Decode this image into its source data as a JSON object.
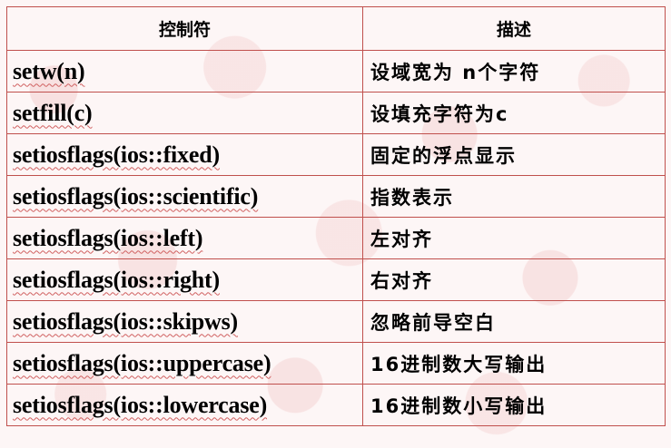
{
  "table": {
    "headers": {
      "control": "控制符",
      "description": "描述"
    },
    "rows": [
      {
        "control": "setw(n)",
        "description": "设域宽为 n个字符"
      },
      {
        "control": "setfill(c)",
        "description": "设填充字符为c"
      },
      {
        "control": "setiosflags(ios::fixed)",
        "description": "固定的浮点显示"
      },
      {
        "control": "setiosflags(ios::scientific)",
        "description": "指数表示"
      },
      {
        "control": "setiosflags(ios::left)",
        "description": "左对齐"
      },
      {
        "control": "setiosflags(ios::right)",
        "description": "右对齐"
      },
      {
        "control": "setiosflags(ios::skipws)",
        "description": "忽略前导空白"
      },
      {
        "control": "setiosflags(ios::uppercase)",
        "description": "16进制数大写输出"
      },
      {
        "control": "setiosflags(ios::lowercase)",
        "description": "16进制数小写输出"
      }
    ]
  },
  "colors": {
    "border": "#c0504d",
    "background": "#fdf6f6"
  }
}
